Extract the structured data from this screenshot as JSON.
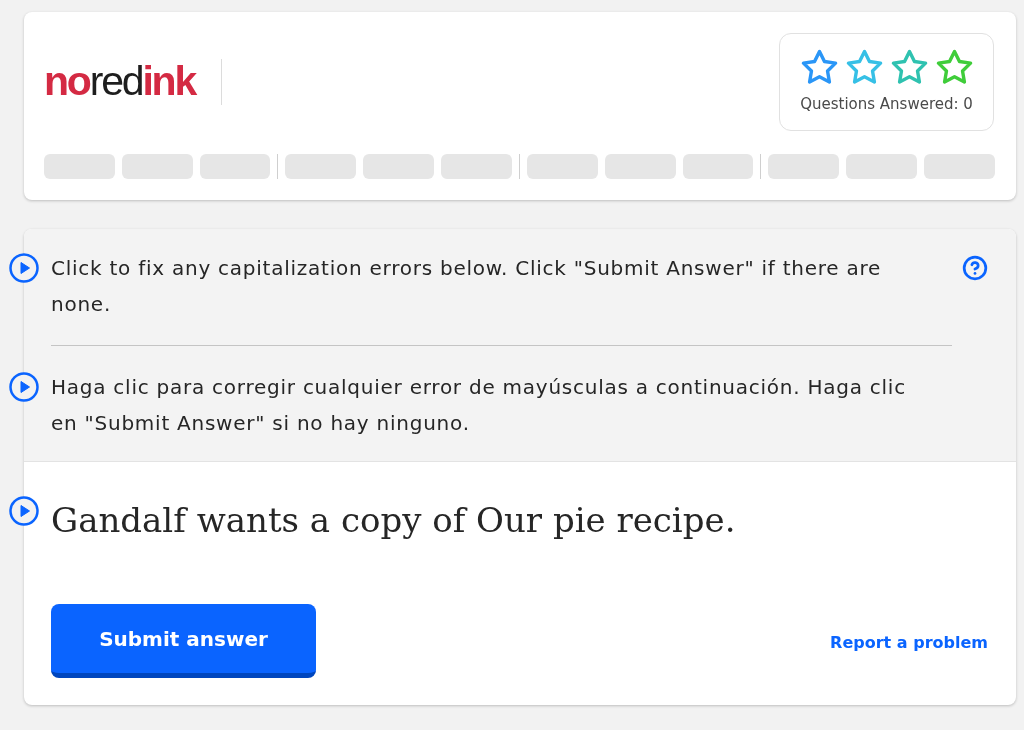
{
  "header": {
    "logo": "**no**red**ink**",
    "stars": 0,
    "questions_answered": "Questions Answered: 0"
  },
  "instructions": [
    {
      "text": "Click to fix any capitalization errors below. Click \"Submit Answer\" if there are none.",
      "help": true
    },
    {
      "text": "Haga clic para corregir cualquier error de mayúsculas a continuación. Haga clic en \"Submit Answer\" si no hay ninguno.",
      "help": false
    }
  ],
  "question": {
    "sentence": "Gandalf wants a copy of Our pie recipe."
  },
  "actions": {
    "submit": "Submit answer",
    "report": "Report a problem"
  }
}
